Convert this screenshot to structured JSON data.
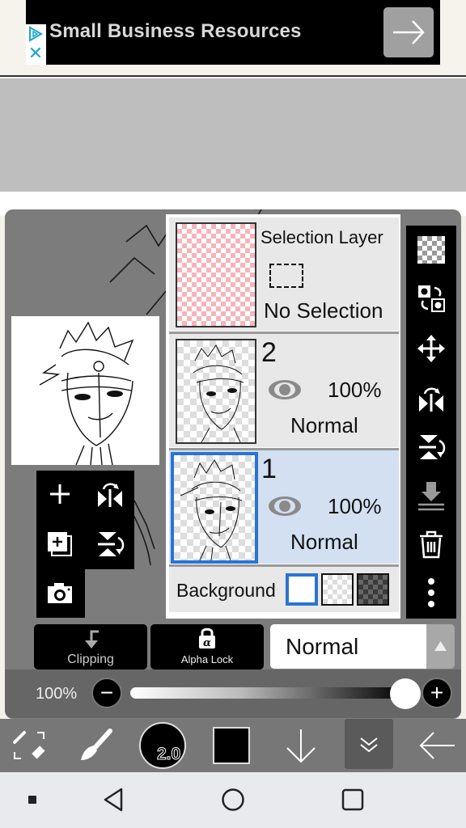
{
  "ad": {
    "title": "Small Business Resources",
    "icons": {
      "play": "ad-choices-play-icon",
      "close": "close-icon",
      "go": "arrow-right-icon"
    }
  },
  "layers_panel": {
    "selection_layer": {
      "title": "Selection Layer",
      "status": "No Selection"
    },
    "layers": [
      {
        "number": "2",
        "opacity": "100%",
        "blend_mode": "Normal",
        "visible": true,
        "selected": false
      },
      {
        "number": "1",
        "opacity": "100%",
        "blend_mode": "Normal",
        "visible": true,
        "selected": true
      }
    ],
    "background": {
      "label": "Background",
      "options": [
        "white",
        "transparent",
        "dark-checker"
      ],
      "selected": "white"
    }
  },
  "side_tools": [
    "transparency-checker-icon",
    "swap-layer-icon",
    "move-icon",
    "flip-horizontal-icon",
    "flip-vertical-icon",
    "merge-down-icon",
    "trash-icon",
    "more-vertical-icon"
  ],
  "quick_tools": [
    "add-layer-icon",
    "flip-horizontal-icon",
    "duplicate-layer-icon",
    "flip-vertical-icon",
    "camera-icon"
  ],
  "controls": {
    "clipping_label": "Clipping",
    "alpha_lock_label": "Alpha Lock",
    "blend_mode": "Normal",
    "opacity_label": "100%",
    "opacity_value": 1.0,
    "minus": "−",
    "plus": "+"
  },
  "bottom_bar": {
    "brush_size": "2.0",
    "color": "#000000",
    "icons": [
      "swap-tools-icon",
      "brush-icon",
      "brush-size-icon",
      "color-swatch-icon",
      "arrow-down-icon",
      "collapse-icon",
      "back-arrow-icon"
    ]
  },
  "nav_bar": {
    "icons": [
      "square-dot-icon",
      "back-triangle-icon",
      "home-circle-icon",
      "recents-square-icon"
    ]
  },
  "colors": {
    "accent_blue": "#2a73d4",
    "selected_layer_bg": "#d3e0f2",
    "selection_pink": "#f6b5b9"
  }
}
